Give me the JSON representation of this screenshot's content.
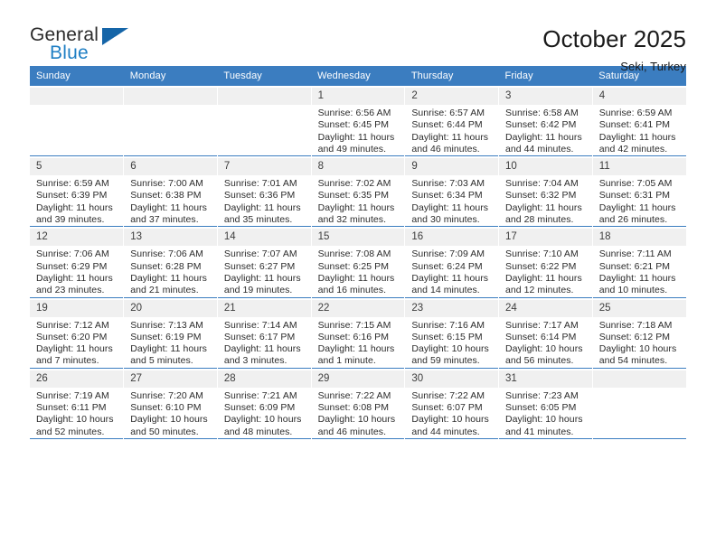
{
  "brand": {
    "word_one": "General",
    "word_two": "Blue",
    "triangle_icon": "triangle-icon",
    "accent_color": "#1f7fc4"
  },
  "header": {
    "title": "October 2025",
    "location": "Seki, Turkey"
  },
  "theme": {
    "header_row_bg": "#3b7dc0",
    "daynum_bg": "#f0f0f0",
    "grid_line": "#3b7dc0"
  },
  "labels": {
    "sunrise": "Sunrise:",
    "sunset": "Sunset:",
    "daylight": "Daylight:"
  },
  "weekdays": [
    "Sunday",
    "Monday",
    "Tuesday",
    "Wednesday",
    "Thursday",
    "Friday",
    "Saturday"
  ],
  "weeks": [
    [
      {
        "day": "",
        "sunrise": "",
        "sunset": "",
        "daylight": "",
        "empty": true
      },
      {
        "day": "",
        "sunrise": "",
        "sunset": "",
        "daylight": "",
        "empty": true
      },
      {
        "day": "",
        "sunrise": "",
        "sunset": "",
        "daylight": "",
        "empty": true
      },
      {
        "day": "1",
        "sunrise": "Sunrise: 6:56 AM",
        "sunset": "Sunset: 6:45 PM",
        "daylight": "Daylight: 11 hours and 49 minutes."
      },
      {
        "day": "2",
        "sunrise": "Sunrise: 6:57 AM",
        "sunset": "Sunset: 6:44 PM",
        "daylight": "Daylight: 11 hours and 46 minutes."
      },
      {
        "day": "3",
        "sunrise": "Sunrise: 6:58 AM",
        "sunset": "Sunset: 6:42 PM",
        "daylight": "Daylight: 11 hours and 44 minutes."
      },
      {
        "day": "4",
        "sunrise": "Sunrise: 6:59 AM",
        "sunset": "Sunset: 6:41 PM",
        "daylight": "Daylight: 11 hours and 42 minutes."
      }
    ],
    [
      {
        "day": "5",
        "sunrise": "Sunrise: 6:59 AM",
        "sunset": "Sunset: 6:39 PM",
        "daylight": "Daylight: 11 hours and 39 minutes."
      },
      {
        "day": "6",
        "sunrise": "Sunrise: 7:00 AM",
        "sunset": "Sunset: 6:38 PM",
        "daylight": "Daylight: 11 hours and 37 minutes."
      },
      {
        "day": "7",
        "sunrise": "Sunrise: 7:01 AM",
        "sunset": "Sunset: 6:36 PM",
        "daylight": "Daylight: 11 hours and 35 minutes."
      },
      {
        "day": "8",
        "sunrise": "Sunrise: 7:02 AM",
        "sunset": "Sunset: 6:35 PM",
        "daylight": "Daylight: 11 hours and 32 minutes."
      },
      {
        "day": "9",
        "sunrise": "Sunrise: 7:03 AM",
        "sunset": "Sunset: 6:34 PM",
        "daylight": "Daylight: 11 hours and 30 minutes."
      },
      {
        "day": "10",
        "sunrise": "Sunrise: 7:04 AM",
        "sunset": "Sunset: 6:32 PM",
        "daylight": "Daylight: 11 hours and 28 minutes."
      },
      {
        "day": "11",
        "sunrise": "Sunrise: 7:05 AM",
        "sunset": "Sunset: 6:31 PM",
        "daylight": "Daylight: 11 hours and 26 minutes."
      }
    ],
    [
      {
        "day": "12",
        "sunrise": "Sunrise: 7:06 AM",
        "sunset": "Sunset: 6:29 PM",
        "daylight": "Daylight: 11 hours and 23 minutes."
      },
      {
        "day": "13",
        "sunrise": "Sunrise: 7:06 AM",
        "sunset": "Sunset: 6:28 PM",
        "daylight": "Daylight: 11 hours and 21 minutes."
      },
      {
        "day": "14",
        "sunrise": "Sunrise: 7:07 AM",
        "sunset": "Sunset: 6:27 PM",
        "daylight": "Daylight: 11 hours and 19 minutes."
      },
      {
        "day": "15",
        "sunrise": "Sunrise: 7:08 AM",
        "sunset": "Sunset: 6:25 PM",
        "daylight": "Daylight: 11 hours and 16 minutes."
      },
      {
        "day": "16",
        "sunrise": "Sunrise: 7:09 AM",
        "sunset": "Sunset: 6:24 PM",
        "daylight": "Daylight: 11 hours and 14 minutes."
      },
      {
        "day": "17",
        "sunrise": "Sunrise: 7:10 AM",
        "sunset": "Sunset: 6:22 PM",
        "daylight": "Daylight: 11 hours and 12 minutes."
      },
      {
        "day": "18",
        "sunrise": "Sunrise: 7:11 AM",
        "sunset": "Sunset: 6:21 PM",
        "daylight": "Daylight: 11 hours and 10 minutes."
      }
    ],
    [
      {
        "day": "19",
        "sunrise": "Sunrise: 7:12 AM",
        "sunset": "Sunset: 6:20 PM",
        "daylight": "Daylight: 11 hours and 7 minutes."
      },
      {
        "day": "20",
        "sunrise": "Sunrise: 7:13 AM",
        "sunset": "Sunset: 6:19 PM",
        "daylight": "Daylight: 11 hours and 5 minutes."
      },
      {
        "day": "21",
        "sunrise": "Sunrise: 7:14 AM",
        "sunset": "Sunset: 6:17 PM",
        "daylight": "Daylight: 11 hours and 3 minutes."
      },
      {
        "day": "22",
        "sunrise": "Sunrise: 7:15 AM",
        "sunset": "Sunset: 6:16 PM",
        "daylight": "Daylight: 11 hours and 1 minute."
      },
      {
        "day": "23",
        "sunrise": "Sunrise: 7:16 AM",
        "sunset": "Sunset: 6:15 PM",
        "daylight": "Daylight: 10 hours and 59 minutes."
      },
      {
        "day": "24",
        "sunrise": "Sunrise: 7:17 AM",
        "sunset": "Sunset: 6:14 PM",
        "daylight": "Daylight: 10 hours and 56 minutes."
      },
      {
        "day": "25",
        "sunrise": "Sunrise: 7:18 AM",
        "sunset": "Sunset: 6:12 PM",
        "daylight": "Daylight: 10 hours and 54 minutes."
      }
    ],
    [
      {
        "day": "26",
        "sunrise": "Sunrise: 7:19 AM",
        "sunset": "Sunset: 6:11 PM",
        "daylight": "Daylight: 10 hours and 52 minutes."
      },
      {
        "day": "27",
        "sunrise": "Sunrise: 7:20 AM",
        "sunset": "Sunset: 6:10 PM",
        "daylight": "Daylight: 10 hours and 50 minutes."
      },
      {
        "day": "28",
        "sunrise": "Sunrise: 7:21 AM",
        "sunset": "Sunset: 6:09 PM",
        "daylight": "Daylight: 10 hours and 48 minutes."
      },
      {
        "day": "29",
        "sunrise": "Sunrise: 7:22 AM",
        "sunset": "Sunset: 6:08 PM",
        "daylight": "Daylight: 10 hours and 46 minutes."
      },
      {
        "day": "30",
        "sunrise": "Sunrise: 7:22 AM",
        "sunset": "Sunset: 6:07 PM",
        "daylight": "Daylight: 10 hours and 44 minutes."
      },
      {
        "day": "31",
        "sunrise": "Sunrise: 7:23 AM",
        "sunset": "Sunset: 6:05 PM",
        "daylight": "Daylight: 10 hours and 41 minutes."
      },
      {
        "day": "",
        "sunrise": "",
        "sunset": "",
        "daylight": "",
        "empty": true
      }
    ]
  ]
}
